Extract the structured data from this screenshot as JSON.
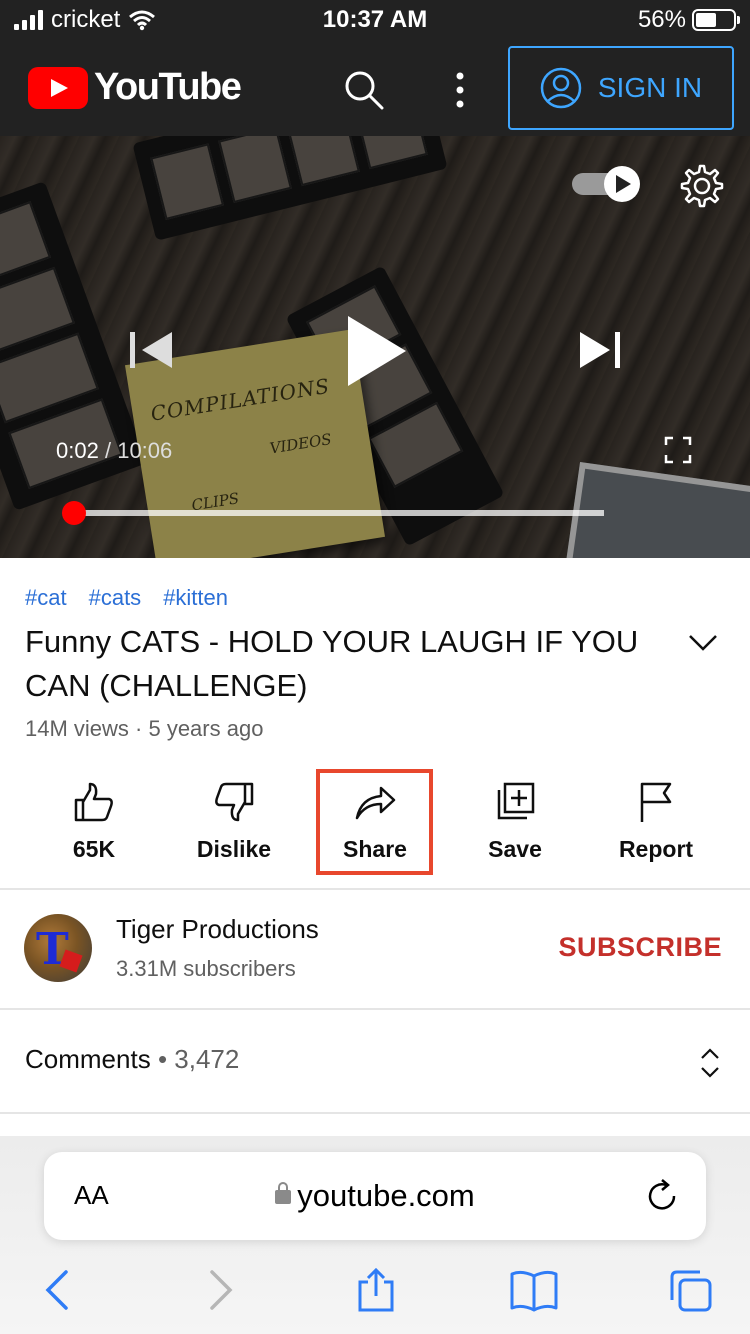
{
  "status_bar": {
    "carrier": "cricket",
    "time": "10:37 AM",
    "battery_percent_text": "56%",
    "battery_level": 0.56
  },
  "header": {
    "logo_text": "YouTube",
    "sign_in_label": "SIGN IN"
  },
  "player": {
    "current_time": "0:02",
    "separator": "/",
    "duration": "10:06",
    "progress_fraction": 0.003,
    "thumbnail_text": {
      "a": "COMPILATIONS",
      "b": "VIDEOS",
      "c": "CLIPS"
    }
  },
  "video": {
    "tags": [
      "#cat",
      "#cats",
      "#kitten"
    ],
    "title": "Funny CATS - HOLD YOUR LAUGH IF YOU CAN (CHALLENGE)",
    "meta": "14M views · 5 years ago"
  },
  "actions": [
    {
      "id": "like",
      "label": "65K",
      "icon": "thumbs-up-icon"
    },
    {
      "id": "dislike",
      "label": "Dislike",
      "icon": "thumbs-down-icon"
    },
    {
      "id": "share",
      "label": "Share",
      "icon": "share-arrow-icon",
      "highlighted": true
    },
    {
      "id": "save",
      "label": "Save",
      "icon": "add-to-playlist-icon"
    },
    {
      "id": "report",
      "label": "Report",
      "icon": "flag-icon"
    }
  ],
  "channel": {
    "name": "Tiger Productions",
    "subscribers": "3.31M subscribers",
    "subscribe_label": "SUBSCRIBE"
  },
  "comments": {
    "label": "Comments",
    "count": "• 3,472"
  },
  "safari": {
    "aa_label": "AA",
    "url": "youtube.com"
  },
  "colors": {
    "accent_blue": "#3ea6ff",
    "tag_blue": "#2b6fd6",
    "subscribe_red": "#c4302b",
    "highlight_red": "#e8472d",
    "youtube_red": "#ff0000"
  }
}
